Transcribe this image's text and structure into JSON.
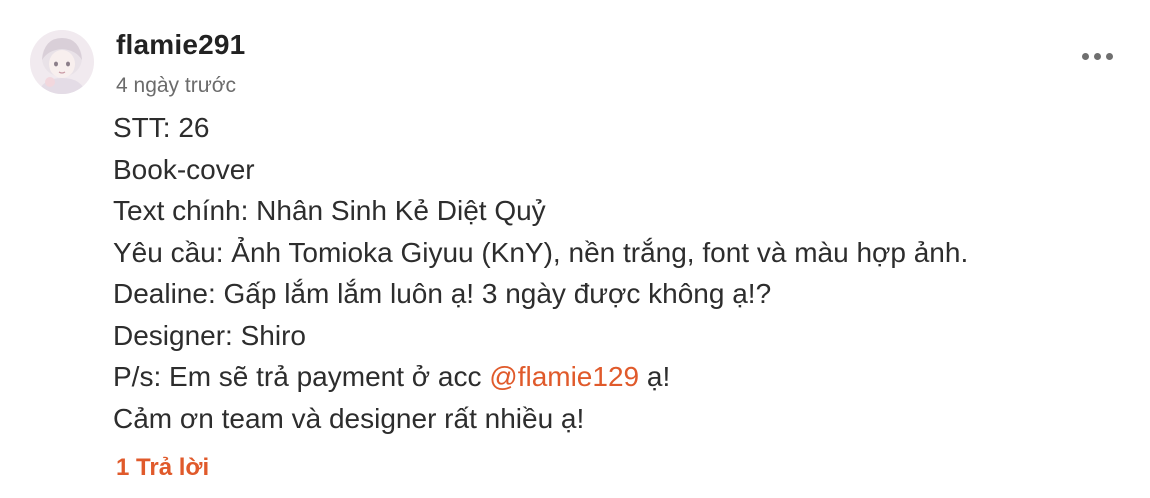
{
  "comment": {
    "author": "flamie291",
    "time_ago": "4 ngày trước",
    "lines": {
      "stt": "STT: 26",
      "type": "Book-cover",
      "main_text": "Text chính: Nhân Sinh Kẻ Diệt Quỷ",
      "request": "Yêu cầu: Ảnh Tomioka Giyuu (KnY), nền trắng, font và màu hợp ảnh.",
      "deadline": "Dealine: Gấp lắm lắm luôn ạ! 3 ngày được không ạ!?",
      "designer": "Designer: Shiro",
      "ps_prefix": "P/s: Em sẽ trả payment ở acc ",
      "ps_mention": "@flamie129",
      "ps_suffix": " ạ!",
      "thanks": "Cảm ơn team và designer rất nhiều ạ!"
    },
    "reply_link": "1 Trả lời",
    "more_icon": "more-horizontal-icon",
    "accent_color": "#e05a2b"
  }
}
